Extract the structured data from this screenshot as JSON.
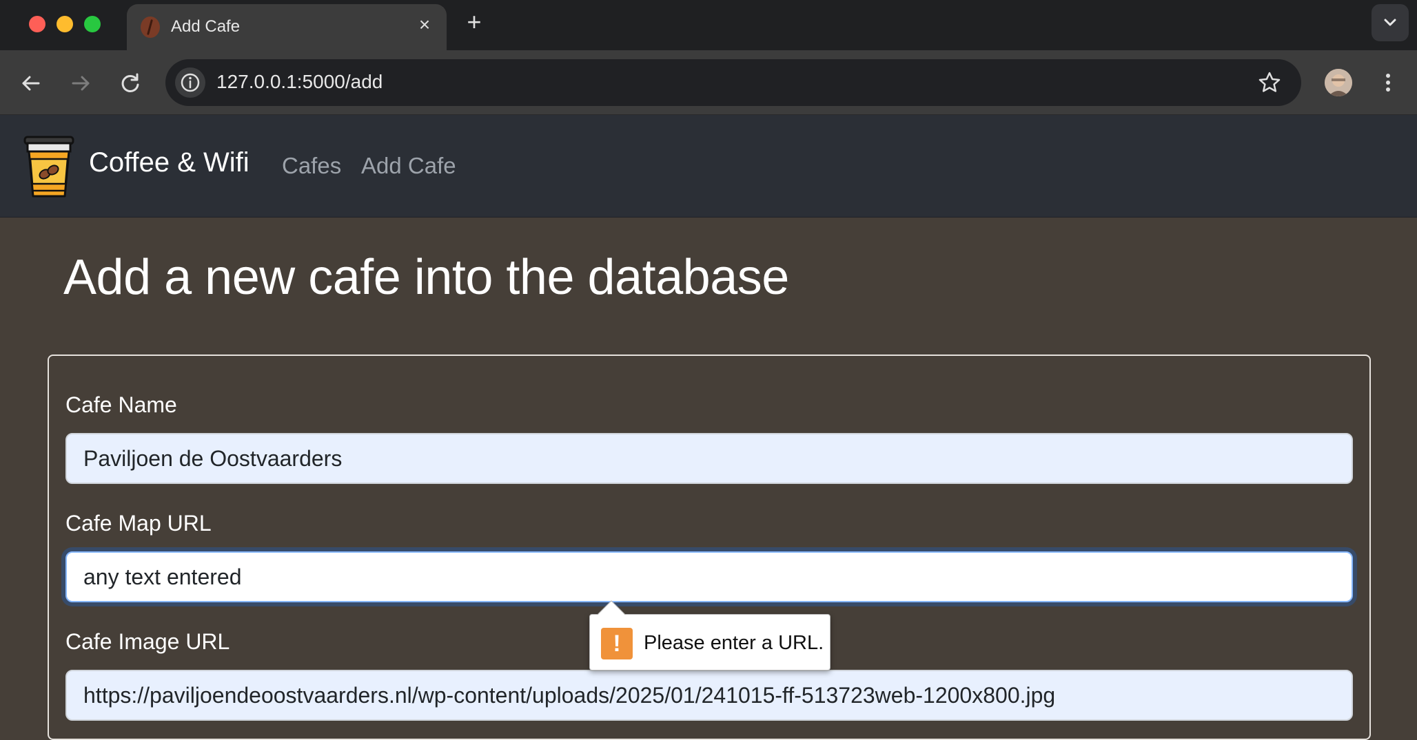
{
  "browser": {
    "tab_title": "Add Cafe",
    "tab_close_glyph": "×",
    "new_tab_glyph": "+",
    "url": "127.0.0.1:5000/add"
  },
  "navbar": {
    "brand": "Coffee & Wifi",
    "links": [
      {
        "label": "Cafes"
      },
      {
        "label": "Add Cafe"
      }
    ]
  },
  "page": {
    "heading": "Add a new cafe into the database"
  },
  "form": {
    "fields": [
      {
        "label": "Cafe Name",
        "value": "Paviljoen de Oostvaarders",
        "state": "autofilled"
      },
      {
        "label": "Cafe Map URL",
        "value": "any text entered",
        "state": "focused"
      },
      {
        "label": "Cafe Image URL",
        "value": "https://paviljoendeoostvaarders.nl/wp-content/uploads/2025/01/241015-ff-513723web-1200x800.jpg",
        "state": "autofilled"
      }
    ]
  },
  "validation": {
    "message": "Please enter a URL.",
    "icon": "warning-icon",
    "icon_glyph": "!",
    "icon_color": "#f0923a"
  },
  "colors": {
    "page_background": "#463f38",
    "navbar_background": "#2b2f36",
    "autofill_background": "#e8f0fe",
    "focus_ring": "#86b7fe"
  }
}
